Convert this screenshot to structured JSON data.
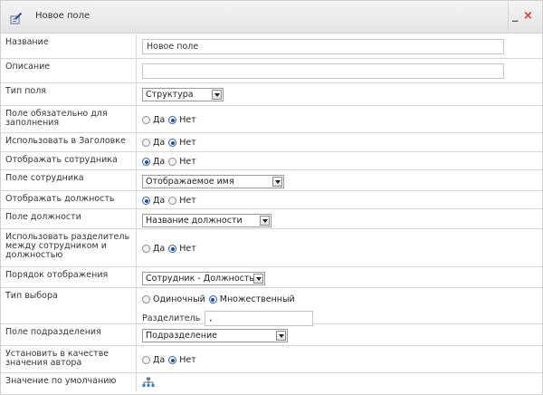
{
  "window": {
    "title": "Новое поле",
    "minimize_glyph": "_",
    "close_glyph": "×"
  },
  "fields": {
    "name": {
      "label": "Название",
      "value": "Новое поле"
    },
    "description": {
      "label": "Описание",
      "value": ""
    },
    "field_type": {
      "label": "Тип поля",
      "selected": "Структура"
    },
    "required": {
      "label": "Поле обязательно для заполнения",
      "yes": "Да",
      "no": "Нет",
      "checked": "no"
    },
    "use_in_header": {
      "label": "Использовать в Заголовке",
      "yes": "Да",
      "no": "Нет",
      "checked": "no"
    },
    "show_employee": {
      "label": "Отображать сотрудника",
      "yes": "Да",
      "no": "Нет",
      "checked": "yes"
    },
    "employee_field": {
      "label": "Поле сотрудника",
      "selected": "Отображаемое имя"
    },
    "show_position": {
      "label": "Отображать должность",
      "yes": "Да",
      "no": "Нет",
      "checked": "yes"
    },
    "position_field": {
      "label": "Поле должности",
      "selected": "Название должности"
    },
    "use_separator": {
      "label": "Использовать разделитель между сотрудником и должностью",
      "yes": "Да",
      "no": "Нет",
      "checked": "no"
    },
    "display_order": {
      "label": "Порядок отображения",
      "selected": "Сотрудник - Должность"
    },
    "selection_type": {
      "label": "Тип выбора",
      "single": "Одиночный",
      "multiple": "Множественный",
      "checked": "multiple",
      "separator_label": "Разделитель",
      "separator_value": ","
    },
    "department_field": {
      "label": "Поле подразделения",
      "selected": "Подразделение"
    },
    "set_as_author": {
      "label": "Установить в качестве значения автора",
      "yes": "Да",
      "no": "Нет",
      "checked": "no"
    },
    "default_value": {
      "label": "Значение по умолчанию"
    }
  },
  "colors": {
    "accent": "#1d4d9b",
    "close": "#d43a2b",
    "border": "#d6d6d6"
  },
  "icons": {
    "title": "edit-field-icon",
    "default_value": "org-structure-icon"
  }
}
